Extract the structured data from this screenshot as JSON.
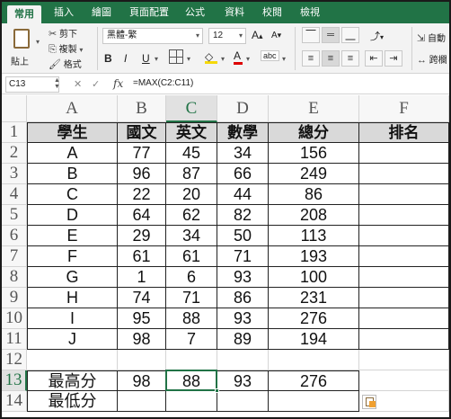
{
  "ribbon_tabs": [
    "常用",
    "插入",
    "繪圖",
    "頁面配置",
    "公式",
    "資料",
    "校閱",
    "檢視"
  ],
  "clipboard": {
    "paste": "貼上",
    "cut": "剪下",
    "copy": "複製",
    "format": "格式"
  },
  "font": {
    "name": "黑體-繁",
    "size": "12"
  },
  "font_buttons": [
    "B",
    "I",
    "U"
  ],
  "right_group": {
    "wrap": "自動",
    "merge": "跨欄"
  },
  "formula_bar": {
    "cell_ref": "C13",
    "formula": "=MAX(C2:C11)"
  },
  "columns": [
    "A",
    "B",
    "C",
    "D",
    "E",
    "F"
  ],
  "rows": [
    "1",
    "2",
    "3",
    "4",
    "5",
    "6",
    "7",
    "8",
    "9",
    "10",
    "11",
    "12",
    "13",
    "14"
  ],
  "table": {
    "headers": [
      "學生",
      "國文",
      "英文",
      "數學",
      "總分",
      "排名"
    ],
    "records": [
      [
        "A",
        "77",
        "45",
        "34",
        "156",
        ""
      ],
      [
        "B",
        "96",
        "87",
        "66",
        "249",
        ""
      ],
      [
        "C",
        "22",
        "20",
        "44",
        "86",
        ""
      ],
      [
        "D",
        "64",
        "62",
        "82",
        "208",
        ""
      ],
      [
        "E",
        "29",
        "34",
        "50",
        "113",
        ""
      ],
      [
        "F",
        "61",
        "61",
        "71",
        "193",
        ""
      ],
      [
        "G",
        "1",
        "6",
        "93",
        "100",
        ""
      ],
      [
        "H",
        "74",
        "71",
        "86",
        "231",
        ""
      ],
      [
        "I",
        "95",
        "88",
        "93",
        "276",
        ""
      ],
      [
        "J",
        "98",
        "7",
        "89",
        "194",
        ""
      ]
    ],
    "summary": [
      [
        "最高分",
        "98",
        "88",
        "93",
        "276"
      ],
      [
        "最低分",
        "",
        "",
        "",
        ""
      ]
    ]
  },
  "selected_cell": "C13",
  "colors": {
    "accent": "#217346",
    "header_fill": "#d9d9d9"
  }
}
